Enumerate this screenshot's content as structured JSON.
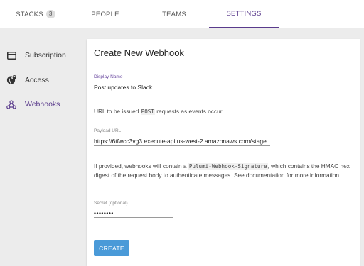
{
  "tabs": [
    {
      "label": "STACKS",
      "badge": "3"
    },
    {
      "label": "PEOPLE"
    },
    {
      "label": "TEAMS"
    },
    {
      "label": "SETTINGS"
    }
  ],
  "active_tab": "SETTINGS",
  "sidebar": {
    "items": [
      {
        "label": "Subscription",
        "icon": "credit-card-icon"
      },
      {
        "label": "Access",
        "icon": "globe-lock-icon"
      },
      {
        "label": "Webhooks",
        "icon": "webhook-icon"
      }
    ],
    "active": "Webhooks"
  },
  "form": {
    "title": "Create New Webhook",
    "display_name": {
      "label": "Display Name",
      "value": "Post updates to Slack"
    },
    "url_hint": {
      "before": "URL to be issued ",
      "code": "POST",
      "after": " requests as events occur."
    },
    "payload_url": {
      "label": "Payload URL",
      "value": "https://6tfwcc3vg3.execute-api.us-west-2.amazonaws.com/stage"
    },
    "secret_hint": {
      "before": "If provided, webhooks will contain a ",
      "code": "Pulumi-Webhook-Signature",
      "after": ", which contains the HMAC hex digest of the request body to authenticate messages. See documentation for more information."
    },
    "secret": {
      "label": "Secret (optional)",
      "value": "••••••••"
    },
    "create_label": "CREATE"
  },
  "colors": {
    "accent": "#5a3b8c",
    "button": "#4a9ad8",
    "background": "#ececec"
  }
}
